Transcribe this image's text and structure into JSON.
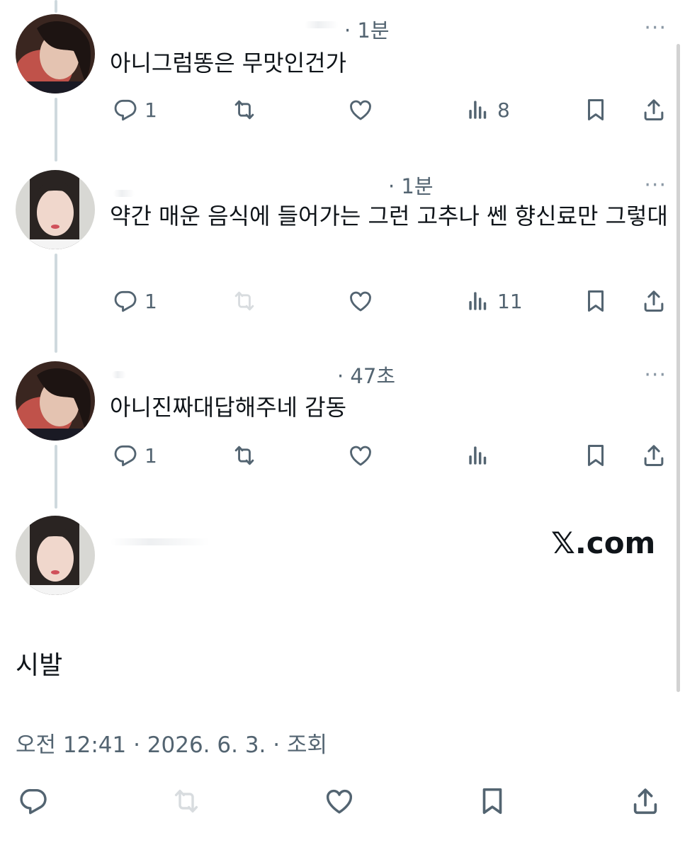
{
  "tweets": [
    {
      "time": "· 1분",
      "more": "···",
      "text": "아니그럼똥은 무맛인건가",
      "replies": "1",
      "retweets": "",
      "likes": "",
      "views": "8"
    },
    {
      "time": "· 1분",
      "more": "···",
      "text": "약간 매운 음식에 들어가는 그런 고추나 쎈 향신료만 그렇대",
      "replies": "1",
      "retweets": "",
      "likes": "",
      "views": "11"
    },
    {
      "time": "· 47초",
      "more": "···",
      "text": "아니진짜대답해주네 감동",
      "replies": "1",
      "retweets": "",
      "likes": "",
      "views": ""
    }
  ],
  "main_tweet": {
    "brand": "𝕏.com",
    "text": "시발",
    "meta": "오전 12:41 · 2026. 6. 3. · 조회"
  },
  "icons": [
    "reply-icon",
    "retweet-icon",
    "like-icon",
    "views-icon",
    "bookmark-icon",
    "share-icon"
  ],
  "colors": {
    "text": "#0f1419",
    "secondary": "#536471",
    "thread_line": "#cfd9de"
  }
}
